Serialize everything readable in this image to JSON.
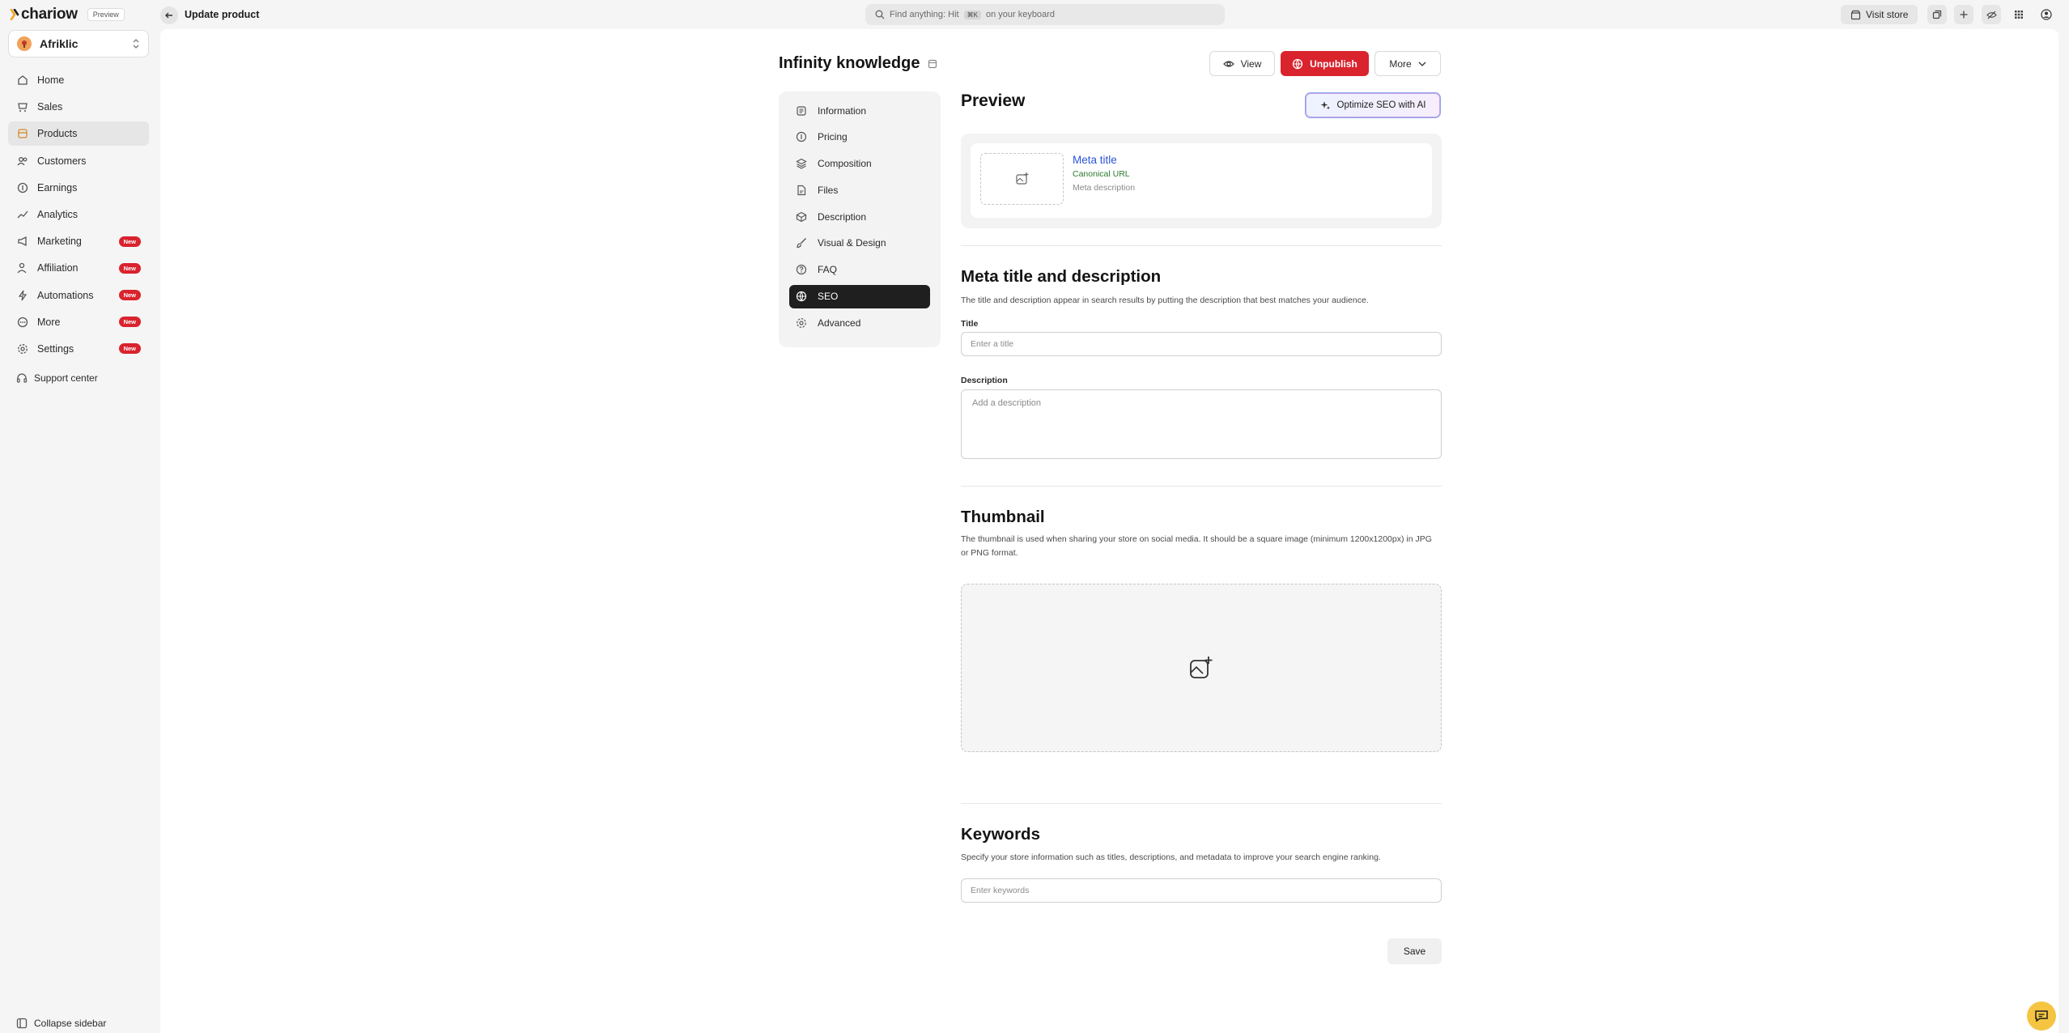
{
  "brand": {
    "name": "chariow",
    "preview_badge": "Preview"
  },
  "store": {
    "name": "Afriklic"
  },
  "sidebar": {
    "items": [
      {
        "label": "Home",
        "icon": "home-icon"
      },
      {
        "label": "Sales",
        "icon": "sales-icon"
      },
      {
        "label": "Products",
        "icon": "products-icon"
      },
      {
        "label": "Customers",
        "icon": "customers-icon"
      },
      {
        "label": "Earnings",
        "icon": "earnings-icon"
      },
      {
        "label": "Analytics",
        "icon": "analytics-icon"
      },
      {
        "label": "Marketing",
        "icon": "marketing-icon",
        "badge": "New"
      },
      {
        "label": "Affiliation",
        "icon": "affiliation-icon",
        "badge": "New"
      },
      {
        "label": "Automations",
        "icon": "automations-icon",
        "badge": "New"
      },
      {
        "label": "More",
        "icon": "more-icon",
        "badge": "New"
      },
      {
        "label": "Settings",
        "icon": "settings-icon",
        "badge": "New"
      }
    ],
    "active": "Products",
    "support_label": "Support center",
    "collapse_label": "Collapse sidebar"
  },
  "topbar": {
    "title": "Update product",
    "search_prefix": "Find anything: Hit",
    "search_kbd": "⌘K",
    "search_suffix": "on your keyboard",
    "visit_store": "Visit store"
  },
  "product": {
    "title": "Infinity knowledge",
    "view_label": "View",
    "unpublish_label": "Unpublish",
    "more_label": "More"
  },
  "subnav": {
    "items": [
      {
        "label": "Information",
        "icon": "info-icon"
      },
      {
        "label": "Pricing",
        "icon": "pricing-icon"
      },
      {
        "label": "Composition",
        "icon": "layers-icon"
      },
      {
        "label": "Files",
        "icon": "file-icon"
      },
      {
        "label": "Description",
        "icon": "description-icon"
      },
      {
        "label": "Visual & Design",
        "icon": "brush-icon"
      },
      {
        "label": "FAQ",
        "icon": "question-icon"
      },
      {
        "label": "SEO",
        "icon": "globe-icon"
      },
      {
        "label": "Advanced",
        "icon": "advanced-icon"
      }
    ],
    "active": "SEO"
  },
  "seo": {
    "preview_heading": "Preview",
    "optimize_label": "Optimize SEO with AI",
    "meta_title": "Meta title",
    "canonical_url": "Canonical URL",
    "meta_description": "Meta description",
    "meta_heading": "Meta title and description",
    "meta_help": "The title and description appear in search results by putting the description that best matches your audience.",
    "title_label": "Title",
    "title_value": "",
    "title_placeholder": "Enter a title",
    "description_label": "Description",
    "description_value": "",
    "description_placeholder": "Add a description",
    "thumbnail_heading": "Thumbnail",
    "thumbnail_help": "The thumbnail is used when sharing your store on social media. It should be a square image (minimum 1200x1200px) in JPG or PNG format.",
    "keywords_heading": "Keywords",
    "keywords_help": "Specify your store information such as titles, descriptions, and metadata to improve your search engine ranking.",
    "keywords_value": "",
    "keywords_placeholder": "Enter keywords",
    "save_label": "Save"
  },
  "colors": {
    "accent": "#d9232d",
    "active_nav": "#1f1f1f",
    "link_blue": "#2a55d6",
    "url_green": "#2d7a2d"
  }
}
